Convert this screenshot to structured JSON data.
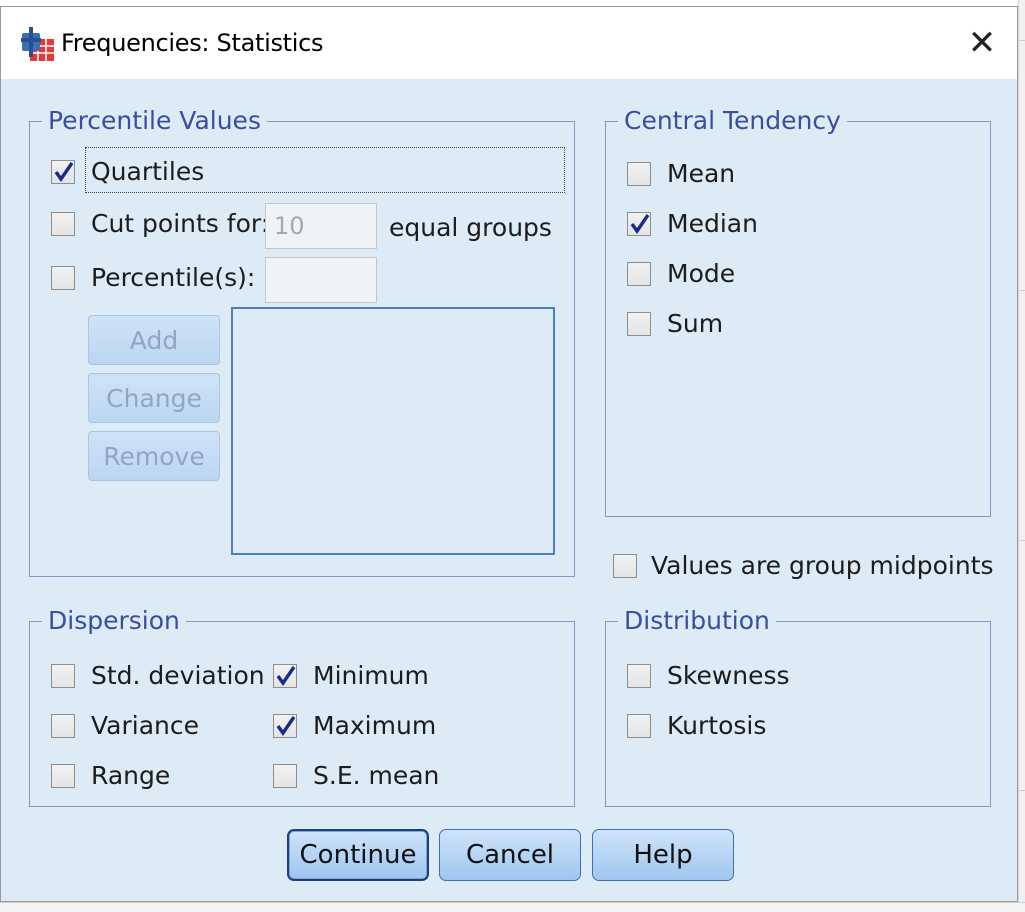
{
  "window": {
    "title": "Frequencies: Statistics",
    "close_glyph": "✕",
    "icon": "spss-frequencies-icon"
  },
  "percentile_values": {
    "title": "Percentile Values",
    "quartiles": {
      "label": "Quartiles",
      "checked": true
    },
    "cut_points": {
      "label": "Cut points for:",
      "value": "10",
      "suffix": "equal groups",
      "checked": false
    },
    "percentiles": {
      "label": "Percentile(s):",
      "value": "",
      "checked": false
    },
    "buttons": {
      "add": "Add",
      "change": "Change",
      "remove": "Remove"
    }
  },
  "central_tendency": {
    "title": "Central Tendency",
    "items": [
      {
        "label": "Mean",
        "checked": false
      },
      {
        "label": "Median",
        "checked": true
      },
      {
        "label": "Mode",
        "checked": false
      },
      {
        "label": "Sum",
        "checked": false
      }
    ]
  },
  "group_midpoints": {
    "label": "Values are group midpoints",
    "checked": false
  },
  "dispersion": {
    "title": "Dispersion",
    "items": [
      {
        "label": "Std. deviation",
        "checked": false
      },
      {
        "label": "Minimum",
        "checked": true
      },
      {
        "label": "Variance",
        "checked": false
      },
      {
        "label": "Maximum",
        "checked": true
      },
      {
        "label": "Range",
        "checked": false
      },
      {
        "label": "S.E. mean",
        "checked": false
      }
    ]
  },
  "distribution": {
    "title": "Distribution",
    "items": [
      {
        "label": "Skewness",
        "checked": false
      },
      {
        "label": "Kurtosis",
        "checked": false
      }
    ]
  },
  "footer": {
    "continue": "Continue",
    "cancel": "Cancel",
    "help": "Help"
  },
  "colors": {
    "dialog_bg": "#ddebf7",
    "group_title": "#3a4ea0",
    "check_mark": "#1a2a8a"
  }
}
